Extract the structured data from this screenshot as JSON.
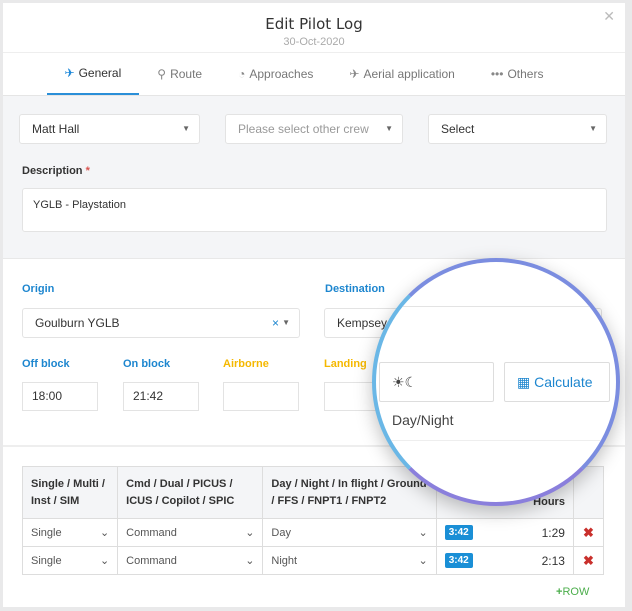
{
  "modal": {
    "title": "Edit Pilot Log",
    "date": "30-Oct-2020",
    "close_icon": "close-icon"
  },
  "tabs": [
    {
      "label": "General",
      "icon": "plane-icon",
      "active": true
    },
    {
      "label": "Route",
      "icon": "map-marker-icon"
    },
    {
      "label": "Approaches",
      "icon": "dashboard-icon"
    },
    {
      "label": "Aerial application",
      "icon": "crop-duster-icon"
    },
    {
      "label": "Others",
      "icon": "ellipsis-icon"
    }
  ],
  "crew": {
    "pilot": "Matt Hall",
    "other_crew_placeholder": "Please select other crew",
    "third": "Select"
  },
  "description": {
    "label": "Description",
    "required": "*",
    "value": "YGLB - Playstation"
  },
  "route": {
    "origin_label": "Origin",
    "origin": "Goulburn YGLB",
    "destination_label": "Destination",
    "destination": "Kempsey Y"
  },
  "times": {
    "off_block_label": "Off block",
    "off_block": "18:00",
    "on_block_label": "On block",
    "on_block": "21:42",
    "airborne_label": "Airborne",
    "airborne": "",
    "landing_label": "Landing",
    "landing": ""
  },
  "buttons": {
    "day_night": "Day/Night",
    "calculate": "Calculate"
  },
  "table": {
    "headers": [
      "Single / Multi / Inst / SIM",
      "Cmd / Dual / PICUS / ICUS / Copilot / SPIC",
      "Day / Night / In flight / Ground / FFS / FNPT1 / FNPT2",
      "Hours"
    ],
    "rows": [
      {
        "type": "Single",
        "role": "Command",
        "period": "Day",
        "badge": "3:42",
        "hours": "1:29"
      },
      {
        "type": "Single",
        "role": "Command",
        "period": "Night",
        "badge": "3:42",
        "hours": "2:13"
      }
    ],
    "add_row": "ROW"
  },
  "colors": {
    "accent": "#1d86cf",
    "warning": "#f5b800",
    "delete": "#c9302c",
    "add": "#4cae4c"
  }
}
